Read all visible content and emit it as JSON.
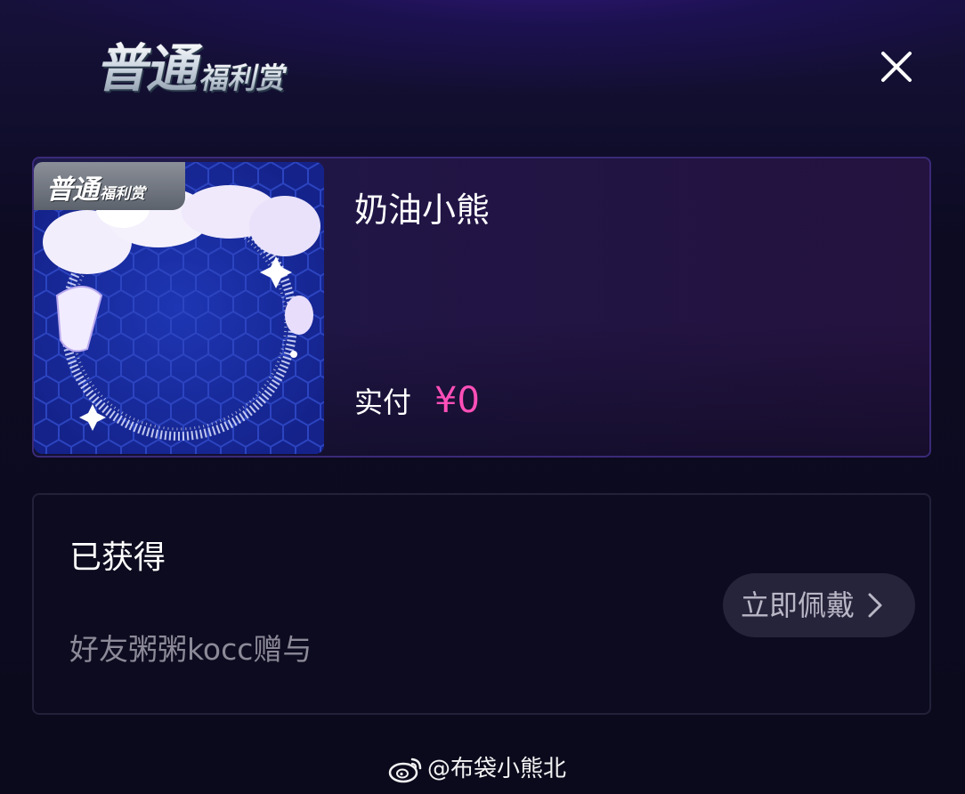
{
  "header": {
    "logo_main": "普通",
    "logo_sub": "福利赏",
    "close_icon": "close-icon"
  },
  "product": {
    "tag_main": "普通",
    "tag_sub": "福利赏",
    "name": "奶油小熊",
    "price_label": "实付",
    "price_value": "¥0",
    "price_color": "#ff4fb8"
  },
  "obtained": {
    "title": "已获得",
    "gift_source": "好友粥粥kocc赠与",
    "wear_button_label": "立即佩戴",
    "wear_button_icon": "chevron-right-icon"
  },
  "watermark": {
    "text": "@布袋小熊北",
    "icon": "weibo-icon"
  },
  "colors": {
    "background": "#0b0a1c",
    "accent_price": "#ff4fb8",
    "card_border": "#3a2a78"
  }
}
